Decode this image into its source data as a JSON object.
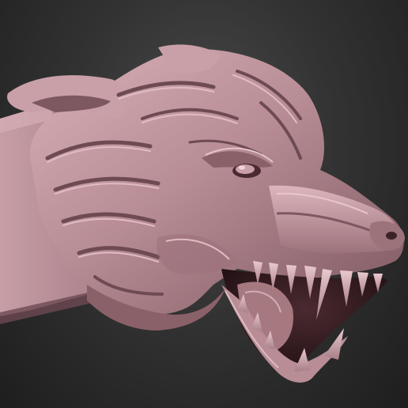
{
  "scene": {
    "subject": "snarling-wolf-head-sculpt",
    "colors": {
      "background_top": "#4a4a4a",
      "background_mid": "#333333",
      "background_edge": "#1e1e1e",
      "clay_base": "#b88d95",
      "clay_light": "#e0bcc2",
      "clay_mid": "#a77c85",
      "clay_shadow": "#6e4a52",
      "clay_deep": "#3d2328",
      "mouth_dark": "#2a1518"
    }
  }
}
